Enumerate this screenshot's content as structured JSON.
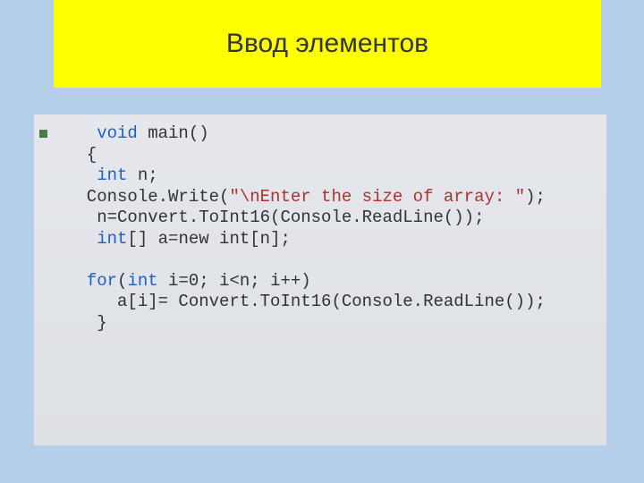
{
  "slide": {
    "title": "Ввод элементов"
  },
  "code": {
    "l1a": "   ",
    "l1_kw": "void",
    "l1b": " main()",
    "l2": "  {",
    "l3a": "   ",
    "l3_kw": "int",
    "l3b": " n;",
    "l4a": "  Console.Write(",
    "l4_str": "\"\\nEnter the size of array: \"",
    "l4b": ");",
    "l5": "   n=Convert.ToInt16(Console.ReadLine());",
    "l6a": "   ",
    "l6_kw": "int",
    "l6b": "[] a=new int[n];",
    "l7": "",
    "l8a": "  ",
    "l8_kw1": "for",
    "l8b": "(",
    "l8_kw2": "int",
    "l8c": " i=0; i<n; i++)",
    "l9": "     a[i]= Convert.ToInt16(Console.ReadLine());",
    "l10": "   }"
  }
}
